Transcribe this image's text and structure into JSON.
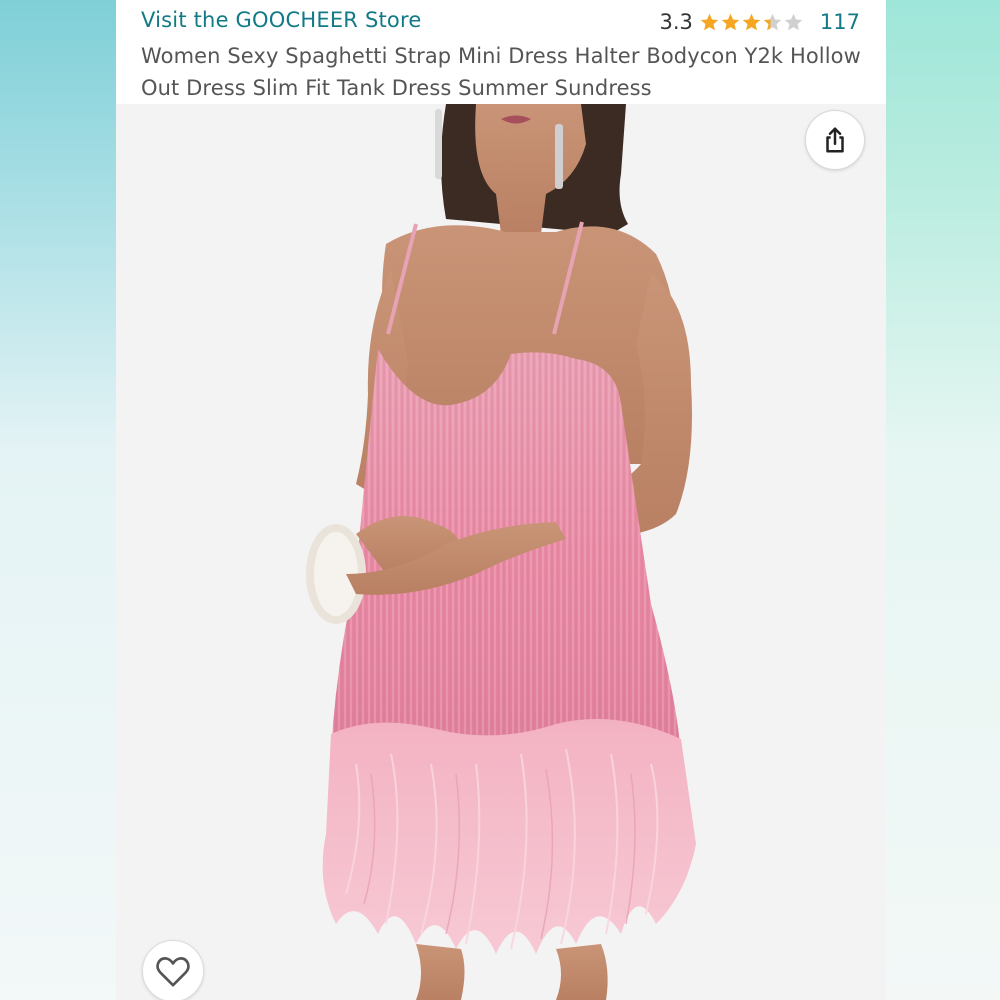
{
  "header": {
    "store_link": "Visit the GOOCHEER Store",
    "rating_value": "3.3",
    "rating_stars": 3.3,
    "rating_count": "117",
    "title": "Women Sexy Spaghetti Strap Mini Dress Halter Bodycon Y2k Hollow Out Dress Slim Fit Tank Dress Summer Sundress"
  },
  "photo": {
    "subject": "product-photo-pink-fringe-feather-mini-dress"
  },
  "actions": {
    "share_icon": "share-icon",
    "favorite_icon": "heart-icon"
  },
  "colors": {
    "link": "#127a86",
    "star": "#f5a623",
    "star_empty": "#d0d0d0",
    "dress_pink": "#e58aa4"
  }
}
